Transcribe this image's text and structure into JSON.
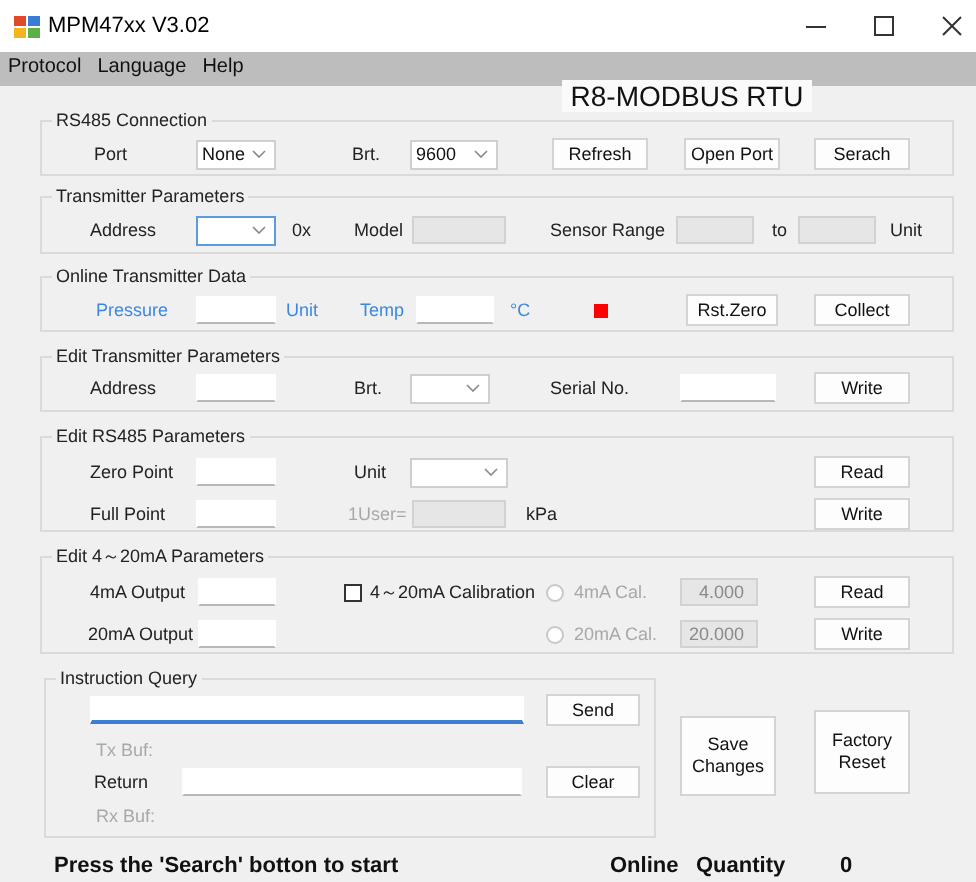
{
  "window": {
    "title": "MPM47xx V3.02"
  },
  "menu": [
    "Protocol",
    "Language",
    "Help"
  ],
  "protocol_banner": "R8-MODBUS RTU",
  "groups": [
    {
      "title": "RS485 Connection",
      "rows": [
        [
          {
            "kind": "label",
            "text": "Port"
          },
          {
            "kind": "combo",
            "value": "None",
            "focused": false
          },
          {
            "kind": "label",
            "text": "Brt."
          },
          {
            "kind": "combo",
            "value": "9600",
            "focused": false
          },
          {
            "kind": "button",
            "label": "Refresh"
          },
          {
            "kind": "button",
            "label": "Open Port"
          },
          {
            "kind": "button",
            "label": "Serach"
          }
        ]
      ]
    },
    {
      "title": "Transmitter Parameters",
      "rows": [
        [
          {
            "kind": "label",
            "text": "Address"
          },
          {
            "kind": "combo",
            "focused": true
          },
          {
            "kind": "label",
            "text": "0x"
          },
          {
            "kind": "label",
            "text": "Model"
          },
          {
            "kind": "field",
            "disabled": true,
            "focused": false
          },
          {
            "kind": "label",
            "text": "Sensor Range"
          },
          {
            "kind": "field",
            "disabled": true,
            "focused": false
          },
          {
            "kind": "label",
            "text": "to"
          },
          {
            "kind": "field",
            "disabled": true,
            "focused": false
          },
          {
            "kind": "label",
            "text": "Unit"
          }
        ]
      ]
    },
    {
      "title": "Online Transmitter Data",
      "rows": [
        [
          {
            "kind": "label",
            "text": "Pressure",
            "color": "#3b88e0"
          },
          {
            "kind": "field",
            "disabled": false,
            "focused": false
          },
          {
            "kind": "label",
            "text": "Unit",
            "color": "#3b88e0"
          },
          {
            "kind": "label",
            "text": "Temp",
            "color": "#3b88e0"
          },
          {
            "kind": "field",
            "disabled": false,
            "focused": false
          },
          {
            "kind": "label",
            "text": "°C",
            "color": "#3b88e0"
          },
          {
            "kind": "indicator",
            "color": "#ff0000"
          },
          {
            "kind": "button",
            "label": "Rst.Zero"
          },
          {
            "kind": "button",
            "label": "Collect"
          }
        ]
      ]
    },
    {
      "title": "Edit Transmitter Parameters",
      "rows": [
        [
          {
            "kind": "label",
            "text": "Address"
          },
          {
            "kind": "field",
            "disabled": false,
            "focused": false
          },
          {
            "kind": "label",
            "text": "Brt."
          },
          {
            "kind": "combo",
            "focused": false
          },
          {
            "kind": "label",
            "text": "Serial No."
          },
          {
            "kind": "field",
            "disabled": false,
            "focused": false
          },
          {
            "kind": "button",
            "label": "Write"
          }
        ]
      ]
    },
    {
      "title": "Edit RS485 Parameters",
      "rows": [
        [
          {
            "kind": "label",
            "text": "Zero Point"
          },
          {
            "kind": "field",
            "disabled": false,
            "focused": false
          },
          {
            "kind": "label",
            "text": "Unit"
          },
          {
            "kind": "combo",
            "focused": false
          },
          "",
          {
            "kind": "button",
            "label": "Read"
          }
        ],
        [
          {
            "kind": "label",
            "text": "Full Point"
          },
          {
            "kind": "field",
            "disabled": false,
            "focused": false
          },
          {
            "kind": "label",
            "text": "1User=",
            "disabled": true
          },
          {
            "kind": "field",
            "disabled": true,
            "focused": false
          },
          {
            "kind": "label",
            "text": "kPa"
          },
          {
            "kind": "button",
            "label": "Write"
          }
        ]
      ]
    },
    {
      "title": "Edit 4～20mA Parameters",
      "rows": [
        [
          {
            "kind": "label",
            "text": "4mA Output"
          },
          {
            "kind": "field",
            "disabled": false,
            "focused": false
          },
          {
            "kind": "checkbox",
            "label": "4～20mA Calibration",
            "checked": false
          },
          {
            "kind": "radio",
            "label": "4mA Cal.",
            "selected": false,
            "disabled": true
          },
          {
            "kind": "field",
            "value": "4.000",
            "disabled": true,
            "focused": false
          },
          {
            "kind": "button",
            "label": "Read"
          }
        ],
        [
          {
            "kind": "label",
            "text": "20mA Output"
          },
          {
            "kind": "field",
            "disabled": false,
            "focused": false
          },
          "",
          {
            "kind": "radio",
            "label": "20mA Cal.",
            "selected": false,
            "disabled": true
          },
          {
            "kind": "field",
            "value": "20.000",
            "disabled": true,
            "focused": false
          },
          {
            "kind": "button",
            "label": "Write"
          }
        ]
      ]
    }
  ],
  "query": {
    "title": "Instruction Query",
    "rows": [
      [
        {
          "kind": "field",
          "disabled": false,
          "focused": true
        },
        {
          "kind": "button",
          "label": "Send"
        }
      ],
      [
        {
          "kind": "label",
          "text": "Tx Buf:",
          "disabled": true
        }
      ],
      [
        {
          "kind": "label",
          "text": "Return"
        },
        {
          "kind": "field",
          "disabled": false,
          "focused": false
        },
        {
          "kind": "button",
          "label": "Clear"
        }
      ],
      [
        {
          "kind": "label",
          "text": "Rx Buf:",
          "disabled": true
        }
      ]
    ]
  },
  "side_buttons": [
    "Save Changes",
    "Factory Reset"
  ],
  "status": {
    "message": "Press the 'Search' botton to start",
    "online_label": "Online",
    "quantity_label": "Quantity",
    "quantity": "0"
  }
}
